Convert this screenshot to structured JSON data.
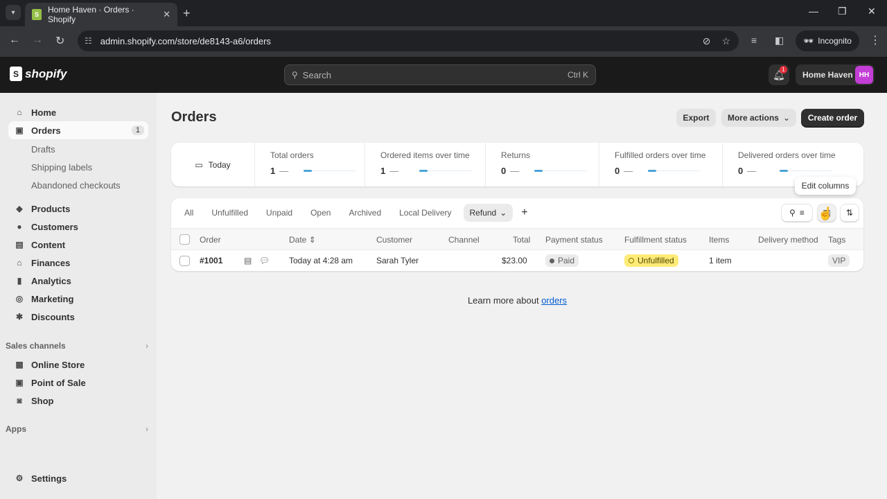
{
  "browser": {
    "tab_title": "Home Haven · Orders · Shopify",
    "url": "admin.shopify.com/store/de8143-a6/orders",
    "profile_label": "Incognito"
  },
  "topbar": {
    "logo_text": "shopify",
    "search_placeholder": "Search",
    "search_shortcut": "Ctrl K",
    "notification_count": "1",
    "store_name": "Home Haven",
    "avatar_initials": "HH"
  },
  "sidebar": {
    "items": [
      {
        "label": "Home",
        "icon": "home-icon"
      },
      {
        "label": "Orders",
        "icon": "inbox-icon",
        "count": "1",
        "active": true
      },
      {
        "label": "Products",
        "icon": "tag-icon"
      },
      {
        "label": "Customers",
        "icon": "person-icon"
      },
      {
        "label": "Content",
        "icon": "image-icon"
      },
      {
        "label": "Finances",
        "icon": "bank-icon"
      },
      {
        "label": "Analytics",
        "icon": "bar-chart-icon"
      },
      {
        "label": "Marketing",
        "icon": "target-icon"
      },
      {
        "label": "Discounts",
        "icon": "discount-icon"
      }
    ],
    "orders_sub": [
      "Drafts",
      "Shipping labels",
      "Abandoned checkouts"
    ],
    "sales_channels_heading": "Sales channels",
    "sales_channels": [
      {
        "label": "Online Store",
        "icon": "store-icon"
      },
      {
        "label": "Point of Sale",
        "icon": "pos-icon"
      },
      {
        "label": "Shop",
        "icon": "shop-icon"
      }
    ],
    "apps_heading": "Apps",
    "settings_label": "Settings"
  },
  "page": {
    "title": "Orders",
    "export_label": "Export",
    "more_actions_label": "More actions",
    "create_order_label": "Create order"
  },
  "metrics": {
    "date_range": "Today",
    "cells": [
      {
        "label": "Total orders",
        "value": "1"
      },
      {
        "label": "Ordered items over time",
        "value": "1"
      },
      {
        "label": "Returns",
        "value": "0"
      },
      {
        "label": "Fulfilled orders over time",
        "value": "0"
      },
      {
        "label": "Delivered orders over time",
        "value": "0"
      }
    ]
  },
  "tooltip": "Edit columns",
  "orders_table": {
    "tabs": [
      "All",
      "Unfulfilled",
      "Unpaid",
      "Open",
      "Archived",
      "Local Delivery",
      "Refund"
    ],
    "selected_tab": "Refund",
    "columns": [
      "Order",
      "Date",
      "Customer",
      "Channel",
      "Total",
      "Payment status",
      "Fulfillment status",
      "Items",
      "Delivery method",
      "Tags"
    ],
    "rows": [
      {
        "order": "#1001",
        "date": "Today at 4:28 am",
        "customer": "Sarah Tyler",
        "channel": "",
        "total": "$23.00",
        "payment_status": "Paid",
        "fulfillment_status": "Unfulfilled",
        "items": "1 item",
        "delivery_method": "",
        "tags": "VIP"
      }
    ]
  },
  "footer": {
    "learn_prefix": "Learn more about ",
    "learn_link": "orders"
  },
  "colors": {
    "primary_button": "#303030",
    "avatar": "#c33ed6",
    "unfulfilled_badge": "#ffeb78",
    "link": "#005bd3"
  }
}
